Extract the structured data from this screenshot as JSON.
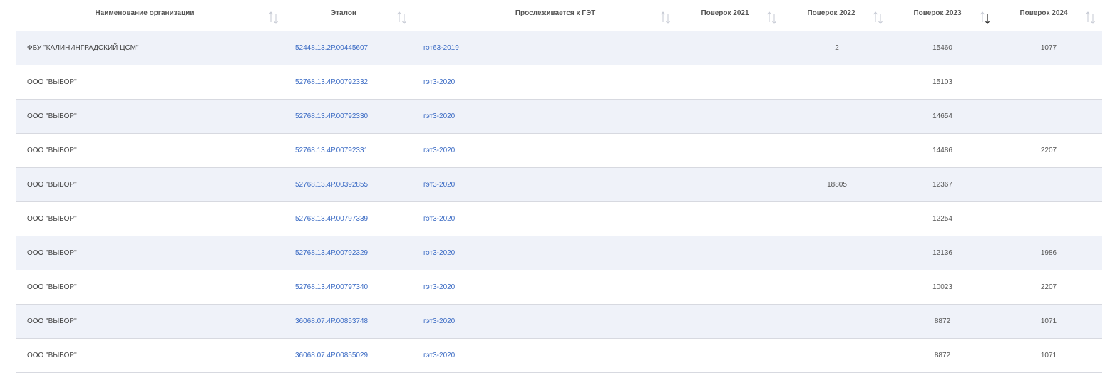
{
  "columns": [
    {
      "key": "org",
      "label": "Наименование организации"
    },
    {
      "key": "etalon",
      "label": "Эталон"
    },
    {
      "key": "get",
      "label": "Прослеживается к ГЭТ"
    },
    {
      "key": "y2021",
      "label": "Поверок 2021"
    },
    {
      "key": "y2022",
      "label": "Поверок 2022"
    },
    {
      "key": "y2023",
      "label": "Поверок 2023",
      "sort": "desc"
    },
    {
      "key": "y2024",
      "label": "Поверок 2024"
    }
  ],
  "rows": [
    {
      "org": "ФБУ \"КАЛИНИНГРАДСКИЙ ЦСМ\"",
      "etalon": "52448.13.2Р.00445607",
      "get": "гэт63-2019",
      "y2021": "",
      "y2022": "2",
      "y2023": "15460",
      "y2024": "1077"
    },
    {
      "org": "ООО \"ВЫБОР\"",
      "etalon": "52768.13.4Р.00792332",
      "get": "гэт3-2020",
      "y2021": "",
      "y2022": "",
      "y2023": "15103",
      "y2024": ""
    },
    {
      "org": "ООО \"ВЫБОР\"",
      "etalon": "52768.13.4Р.00792330",
      "get": "гэт3-2020",
      "y2021": "",
      "y2022": "",
      "y2023": "14654",
      "y2024": ""
    },
    {
      "org": "ООО \"ВЫБОР\"",
      "etalon": "52768.13.4Р.00792331",
      "get": "гэт3-2020",
      "y2021": "",
      "y2022": "",
      "y2023": "14486",
      "y2024": "2207"
    },
    {
      "org": "ООО \"ВЫБОР\"",
      "etalon": "52768.13.4Р.00392855",
      "get": "гэт3-2020",
      "y2021": "",
      "y2022": "18805",
      "y2023": "12367",
      "y2024": ""
    },
    {
      "org": "ООО \"ВЫБОР\"",
      "etalon": "52768.13.4Р.00797339",
      "get": "гэт3-2020",
      "y2021": "",
      "y2022": "",
      "y2023": "12254",
      "y2024": ""
    },
    {
      "org": "ООО \"ВЫБОР\"",
      "etalon": "52768.13.4Р.00792329",
      "get": "гэт3-2020",
      "y2021": "",
      "y2022": "",
      "y2023": "12136",
      "y2024": "1986"
    },
    {
      "org": "ООО \"ВЫБОР\"",
      "etalon": "52768.13.4Р.00797340",
      "get": "гэт3-2020",
      "y2021": "",
      "y2022": "",
      "y2023": "10023",
      "y2024": "2207"
    },
    {
      "org": "ООО \"ВЫБОР\"",
      "etalon": "36068.07.4Р.00853748",
      "get": "гэт3-2020",
      "y2021": "",
      "y2022": "",
      "y2023": "8872",
      "y2024": "1071"
    },
    {
      "org": "ООО \"ВЫБОР\"",
      "etalon": "36068.07.4Р.00855029",
      "get": "гэт3-2020",
      "y2021": "",
      "y2022": "",
      "y2023": "8872",
      "y2024": "1071"
    }
  ],
  "colors": {
    "link": "#3b6bc4",
    "row_alt": "#eff2f9",
    "border": "#d7d9e0",
    "sort_idle": "#c5c9d3",
    "sort_active": "#333333"
  }
}
